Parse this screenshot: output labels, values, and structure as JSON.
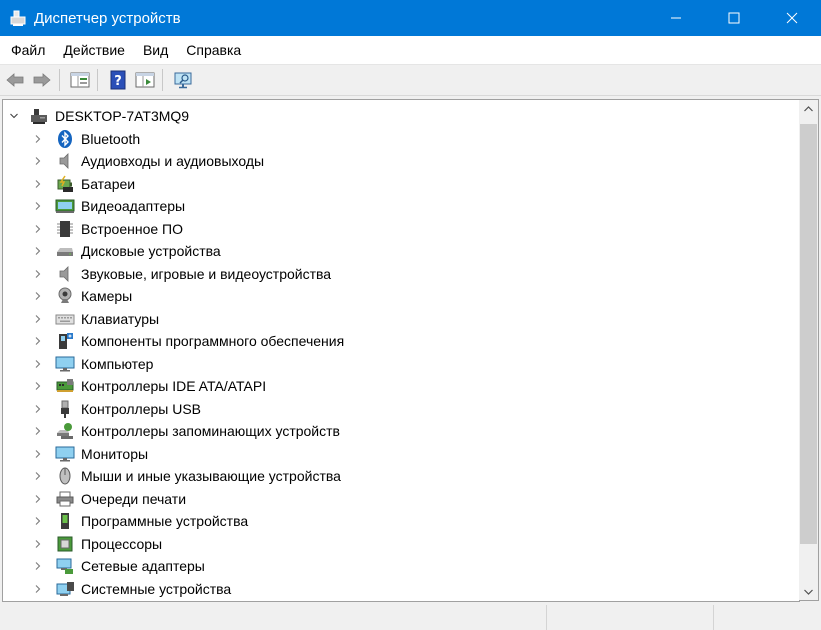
{
  "window": {
    "title": "Диспетчер устройств",
    "controls": [
      "minimize-icon",
      "maximize-icon",
      "close-icon"
    ]
  },
  "menu": [
    "Файл",
    "Действие",
    "Вид",
    "Справка"
  ],
  "toolbar": {
    "buttons": [
      "back-icon",
      "forward-icon",
      "properties-icon",
      "help-icon",
      "update-driver-icon",
      "monitor-scan-icon"
    ]
  },
  "tree": {
    "root": {
      "label": "DESKTOP-7AT3MQ9",
      "icon": "computer-icon",
      "expanded": true
    },
    "categories": [
      {
        "label": "Bluetooth",
        "icon": "bluetooth-icon"
      },
      {
        "label": "Аудиовходы и аудиовыходы",
        "icon": "speaker-icon"
      },
      {
        "label": "Батареи",
        "icon": "battery-icon"
      },
      {
        "label": "Видеоадаптеры",
        "icon": "display-adapter-icon"
      },
      {
        "label": "Встроенное ПО",
        "icon": "firmware-chip-icon"
      },
      {
        "label": "Дисковые устройства",
        "icon": "disk-drive-icon"
      },
      {
        "label": "Звуковые, игровые и видеоустройства",
        "icon": "speaker-icon"
      },
      {
        "label": "Камеры",
        "icon": "webcam-icon"
      },
      {
        "label": "Клавиатуры",
        "icon": "keyboard-icon"
      },
      {
        "label": "Компоненты программного обеспечения",
        "icon": "software-component-icon"
      },
      {
        "label": "Компьютер",
        "icon": "monitor-icon"
      },
      {
        "label": "Контроллеры IDE ATA/ATAPI",
        "icon": "ide-controller-icon"
      },
      {
        "label": "Контроллеры USB",
        "icon": "usb-icon"
      },
      {
        "label": "Контроллеры запоминающих устройств",
        "icon": "storage-controller-icon"
      },
      {
        "label": "Мониторы",
        "icon": "monitor-icon"
      },
      {
        "label": "Мыши и иные указывающие устройства",
        "icon": "mouse-icon"
      },
      {
        "label": "Очереди печати",
        "icon": "printer-icon"
      },
      {
        "label": "Программные устройства",
        "icon": "software-device-icon"
      },
      {
        "label": "Процессоры",
        "icon": "processor-icon"
      },
      {
        "label": "Сетевые адаптеры",
        "icon": "network-adapter-icon"
      },
      {
        "label": "Системные устройства",
        "icon": "system-devices-icon"
      }
    ]
  },
  "colors": {
    "titlebar": "#0078d7",
    "bluetooth": "#1565c0"
  }
}
